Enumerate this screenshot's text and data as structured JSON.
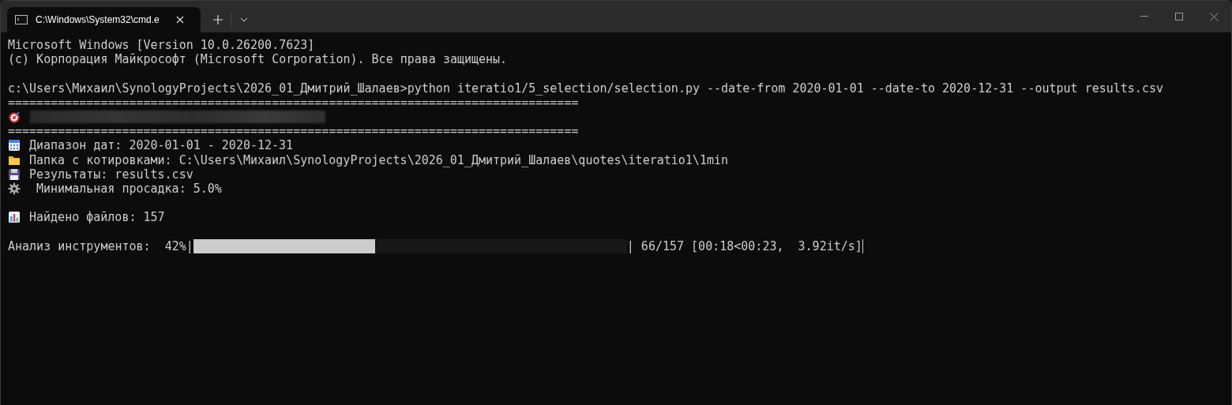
{
  "window": {
    "tab": {
      "title": "C:\\Windows\\System32\\cmd.e",
      "selected": true
    }
  },
  "lines": [
    {
      "kind": "text",
      "text": "Microsoft Windows [Version 10.0.26200.7623]"
    },
    {
      "kind": "text",
      "text": "(c) Корпорация Майкрософт (Microsoft Corporation). Все права защищены."
    },
    {
      "kind": "blank"
    },
    {
      "kind": "text",
      "text": "c:\\Users\\Михаил\\SynologyProjects\\2026_01_Дмитрий_Шалаев>python iteratio1/5_selection/selection.py --date-from 2020-01-01 --date-to 2020-12-31 --output results.csv"
    },
    {
      "kind": "text",
      "text": "================================================================================"
    },
    {
      "kind": "redacted"
    },
    {
      "kind": "text",
      "text": "================================================================================"
    },
    {
      "kind": "icon",
      "text": "Диапазон дат: 2020-01-01 - 2020-12-31"
    },
    {
      "kind": "icon",
      "text": "Папка с котировками: C:\\Users\\Михаил\\SynologyProjects\\2026_01_Дмитрий_Шалаев\\quotes\\iteratio1\\1min"
    },
    {
      "kind": "icon",
      "text": "Результаты: results.csv"
    },
    {
      "kind": "icon",
      "text": " Минимальная просадка: 5.0%"
    },
    {
      "kind": "blank"
    },
    {
      "kind": "icon",
      "text": "Найдено файлов: 157"
    },
    {
      "kind": "blank"
    },
    {
      "kind": "progress",
      "text": "Анализ инструментов:  42%|",
      "level": 0.42,
      "suffix": "| 66/157 [00:18<00:23,  3.92it/s]"
    }
  ]
}
